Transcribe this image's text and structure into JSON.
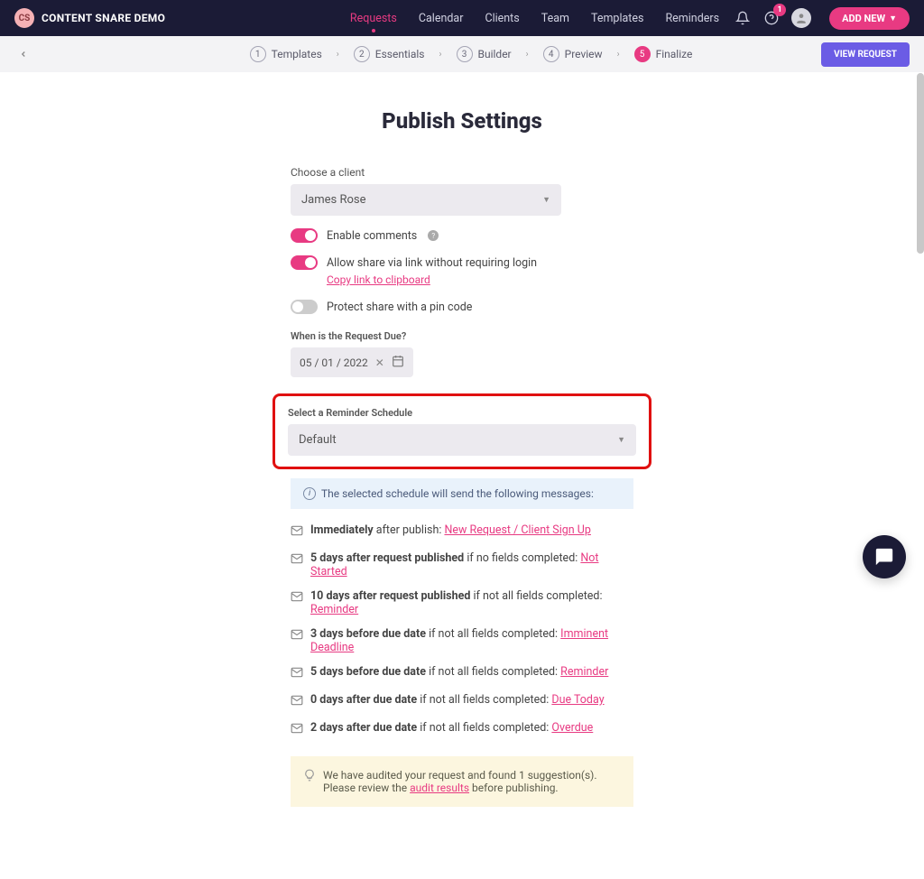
{
  "brand": {
    "initials": "CS",
    "name": "CONTENT SNARE DEMO"
  },
  "nav": {
    "items": [
      "Requests",
      "Calendar",
      "Clients",
      "Team",
      "Templates",
      "Reminders"
    ],
    "active_index": 0,
    "help_badge": "1",
    "add_new": "ADD NEW"
  },
  "steps": {
    "items": [
      {
        "num": "1",
        "label": "Templates"
      },
      {
        "num": "2",
        "label": "Essentials"
      },
      {
        "num": "3",
        "label": "Builder"
      },
      {
        "num": "4",
        "label": "Preview"
      },
      {
        "num": "5",
        "label": "Finalize"
      }
    ],
    "active_index": 4,
    "view_request": "VIEW REQUEST"
  },
  "page_title": "Publish Settings",
  "client": {
    "label": "Choose a client",
    "value": "James Rose"
  },
  "toggles": {
    "comments": {
      "label": "Enable comments",
      "on": true
    },
    "share": {
      "label": "Allow share via link without requiring login",
      "on": true,
      "copy": "Copy link to clipboard"
    },
    "pin": {
      "label": "Protect share with a pin code",
      "on": false
    }
  },
  "due": {
    "label": "When is the Request Due?",
    "value": "05 / 01 / 2022"
  },
  "reminder": {
    "label": "Select a Reminder Schedule",
    "value": "Default"
  },
  "info_bar": "The selected schedule will send the following messages:",
  "schedule": [
    {
      "bold": "Immediately",
      "mid": " after publish: ",
      "link": "New Request / Client Sign Up"
    },
    {
      "bold": "5 days after request published",
      "mid": " if no fields completed: ",
      "link": "Not Started"
    },
    {
      "bold": "10 days after request published",
      "mid": " if not all fields completed: ",
      "link": "Reminder"
    },
    {
      "bold": "3 days before due date",
      "mid": " if not all fields completed: ",
      "link": "Imminent Deadline"
    },
    {
      "bold": "5 days before due date",
      "mid": " if not all fields completed: ",
      "link": "Reminder"
    },
    {
      "bold": "0 days after due date",
      "mid": " if not all fields completed: ",
      "link": "Due Today"
    },
    {
      "bold": "2 days after due date",
      "mid": " if not all fields completed: ",
      "link": "Overdue"
    }
  ],
  "audit": {
    "line1": "We have audited your request and found 1 suggestion(s).",
    "line2_pre": "Please review the ",
    "line2_link": "audit results",
    "line2_post": " before publishing."
  }
}
